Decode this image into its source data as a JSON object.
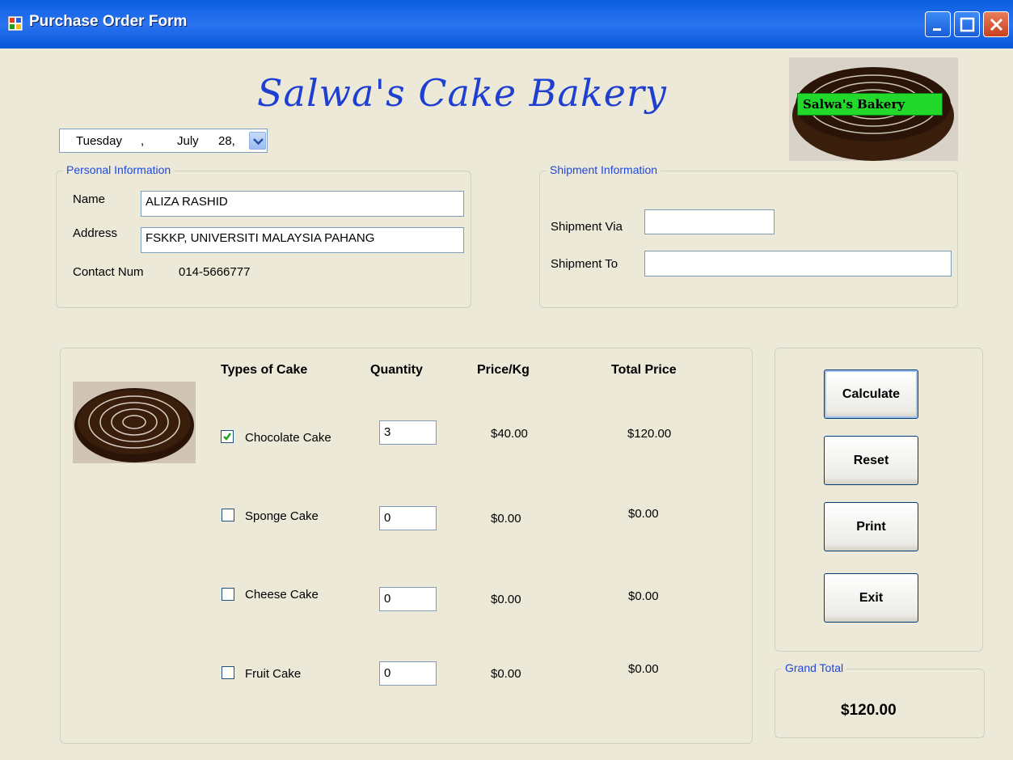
{
  "window": {
    "title": "Purchase Order Form"
  },
  "header": {
    "bakery_name": "Salwa's Cake Bakery",
    "logo_label": "Salwa's Bakery"
  },
  "date": {
    "weekday": "Tuesday",
    "separator": ",",
    "month": "July",
    "day": "28,"
  },
  "personal": {
    "legend": "Personal Information",
    "name_label": "Name",
    "name_value": "ALIZA RASHID",
    "address_label": "Address",
    "address_value": "FSKKP, UNIVERSITI MALAYSIA PAHANG",
    "contact_label": "Contact Num",
    "contact_value": "014-5666777"
  },
  "shipment": {
    "legend": "Shipment Information",
    "via_label": "Shipment Via",
    "via_value": "",
    "to_label": "Shipment To",
    "to_value": ""
  },
  "order": {
    "headers": {
      "type": "Types of Cake",
      "quantity": "Quantity",
      "price": "Price/Kg",
      "total": "Total Price"
    },
    "items": [
      {
        "name": "Chocolate Cake",
        "checked": true,
        "quantity": "3",
        "price": "$40.00",
        "total": "$120.00"
      },
      {
        "name": "Sponge Cake",
        "checked": false,
        "quantity": "0",
        "price": "$0.00",
        "total": "$0.00"
      },
      {
        "name": "Cheese Cake",
        "checked": false,
        "quantity": "0",
        "price": "$0.00",
        "total": "$0.00"
      },
      {
        "name": "Fruit Cake",
        "checked": false,
        "quantity": "0",
        "price": "$0.00",
        "total": "$0.00"
      }
    ]
  },
  "buttons": {
    "calculate": "Calculate",
    "reset": "Reset",
    "print": "Print",
    "exit": "Exit"
  },
  "grand_total": {
    "legend": "Grand Total",
    "value": "$120.00"
  },
  "colors": {
    "accent": "#2148d8",
    "titlebar": "#0a5ee0",
    "logo_label_bg": "#22d82a"
  }
}
